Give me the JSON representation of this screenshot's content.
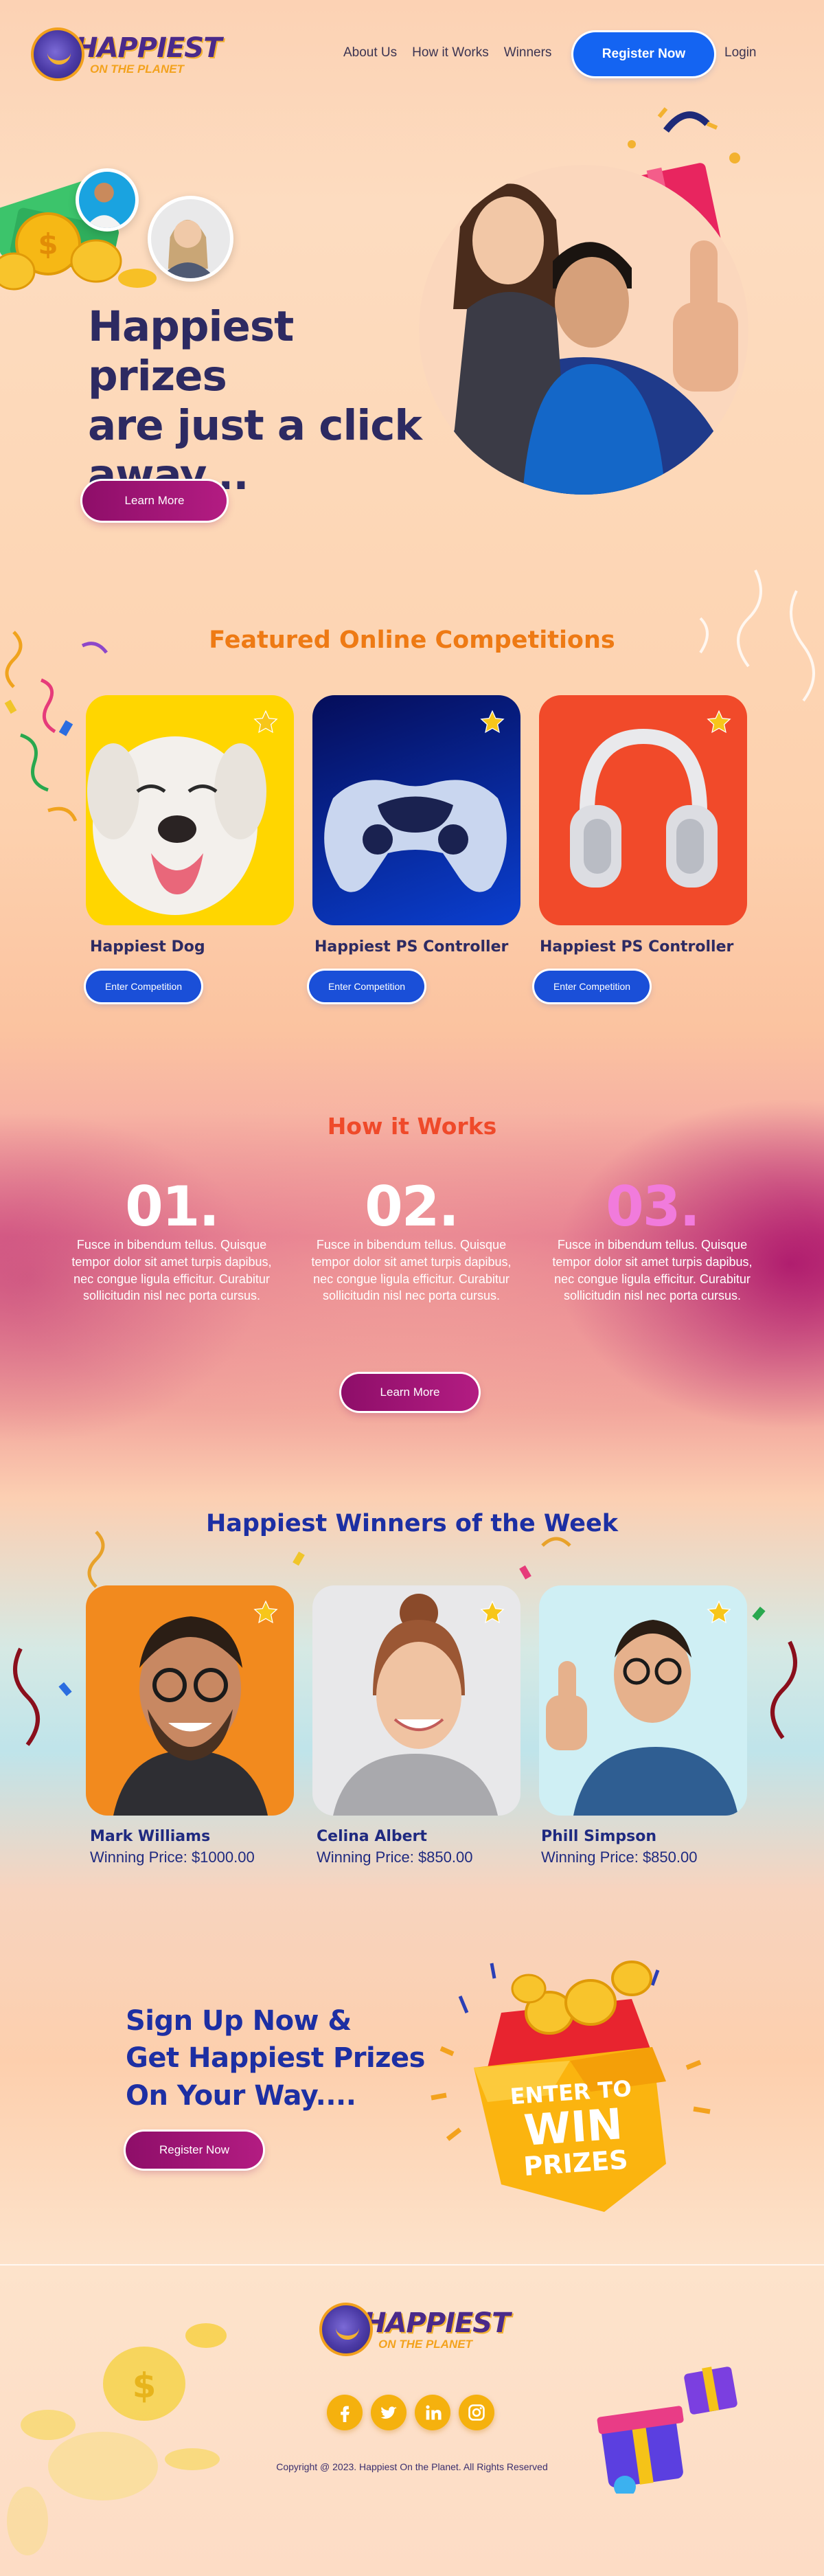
{
  "header": {
    "logo_main": "HAPPIEST",
    "logo_sub": "ON THE PLANET",
    "nav": [
      "About Us",
      "How it Works",
      "Winners"
    ],
    "register_label": "Register Now",
    "login_label": "Login"
  },
  "hero": {
    "title": "Happiest prizes\nare just a click\naway...",
    "cta_label": "Learn More"
  },
  "featured": {
    "title": "Featured Online Competitions",
    "cards": [
      {
        "title": "Happiest Dog",
        "button": "Enter Competition",
        "bg": "#ffd600"
      },
      {
        "title": "Happiest PS Controller",
        "button": "Enter Competition",
        "bg": "#0a35b8"
      },
      {
        "title": "Happiest PS Controller",
        "button": "Enter Competition",
        "bg": "#f14a2a"
      }
    ]
  },
  "how": {
    "title": "How it Works",
    "steps": [
      {
        "num": "01.",
        "text": "Fusce in bibendum tellus. Quisque tempor dolor sit amet turpis dapibus, nec congue ligula efficitur. Curabitur sollicitudin nisl nec porta cursus."
      },
      {
        "num": "02.",
        "text": "Fusce in bibendum tellus. Quisque tempor dolor sit amet turpis dapibus, nec congue ligula efficitur. Curabitur sollicitudin nisl nec porta cursus."
      },
      {
        "num": "03.",
        "text": "Fusce in bibendum tellus. Quisque tempor dolor sit amet turpis dapibus, nec congue ligula efficitur. Curabitur sollicitudin nisl nec porta cursus."
      }
    ],
    "cta_label": "Learn More"
  },
  "winners": {
    "title": "Happiest Winners of the Week",
    "people": [
      {
        "name": "Mark Williams",
        "price": "Winning Price: $1000.00",
        "bg": "#f28a1e"
      },
      {
        "name": "Celina Albert",
        "price": "Winning Price: $850.00",
        "bg": "#e8e8ea"
      },
      {
        "name": "Phill Simpson",
        "price": "Winning Price: $850.00",
        "bg": "#cfeff4"
      }
    ]
  },
  "signup": {
    "title": "Sign Up Now &\nGet Happiest Prizes\nOn Your Way....",
    "cta_label": "Register Now",
    "box_line1": "ENTER TO",
    "box_line2": "WIN",
    "box_line3": "PRIZES"
  },
  "footer": {
    "logo_main": "HAPPIEST",
    "logo_sub": "ON THE PLANET",
    "social_icons": [
      "facebook-icon",
      "twitter-icon",
      "linkedin-icon",
      "instagram-icon"
    ],
    "copyright": "Copyright @ 2023. Happiest On the Planet. All Rights Reserved"
  },
  "colors": {
    "accent_blue": "#1464f2",
    "accent_magenta": "#8e0e69",
    "title_orange": "#ee7a14",
    "title_red": "#ef4a2a",
    "title_navy": "#1d2fa3"
  }
}
